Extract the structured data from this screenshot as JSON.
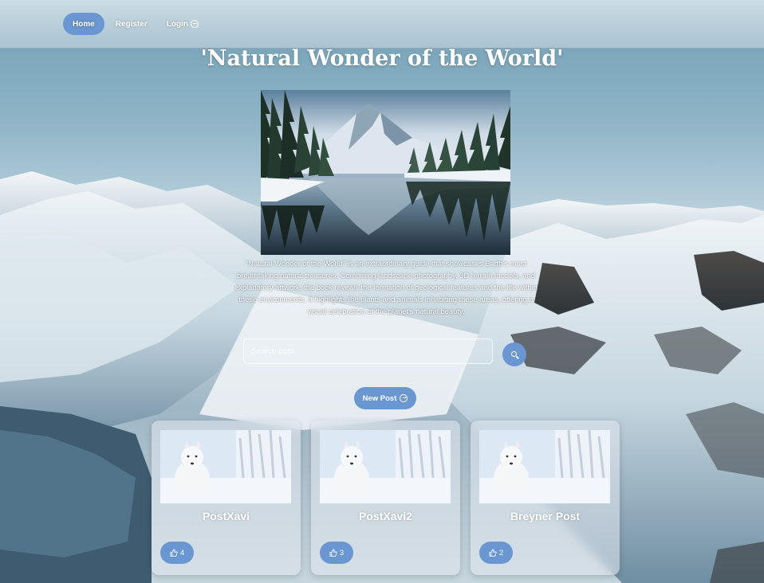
{
  "nav": {
    "home": "Home",
    "register": "Register",
    "login": "Login"
  },
  "page_title": "'Natural Wonder of the World'",
  "description": "\"Natural Wonder of the World\" is an extraordinary guide that showcases Earth's most breathtaking natural treasures. Combining landscape photography, 3D terrain models, and explanatory artwork, the book reveals the formation of geological features and the life within these environments. It highlights the plants and animals inhabiting these areas, offering a visual celebration of the planet's natural beauty.",
  "search": {
    "placeholder": "Search post"
  },
  "new_post_label": "New Post",
  "posts": [
    {
      "title": "PostXavi",
      "likes": "4"
    },
    {
      "title": "PostXavi2",
      "likes": "3"
    },
    {
      "title": "Breyner Post",
      "likes": "2"
    }
  ],
  "colors": {
    "accent": "#6a97d1",
    "text": "#ffffff"
  },
  "icons": {
    "login": "login-arrow-icon",
    "search": "search-icon",
    "new_post": "arrow-circle-icon",
    "like": "thumbs-up-icon"
  }
}
